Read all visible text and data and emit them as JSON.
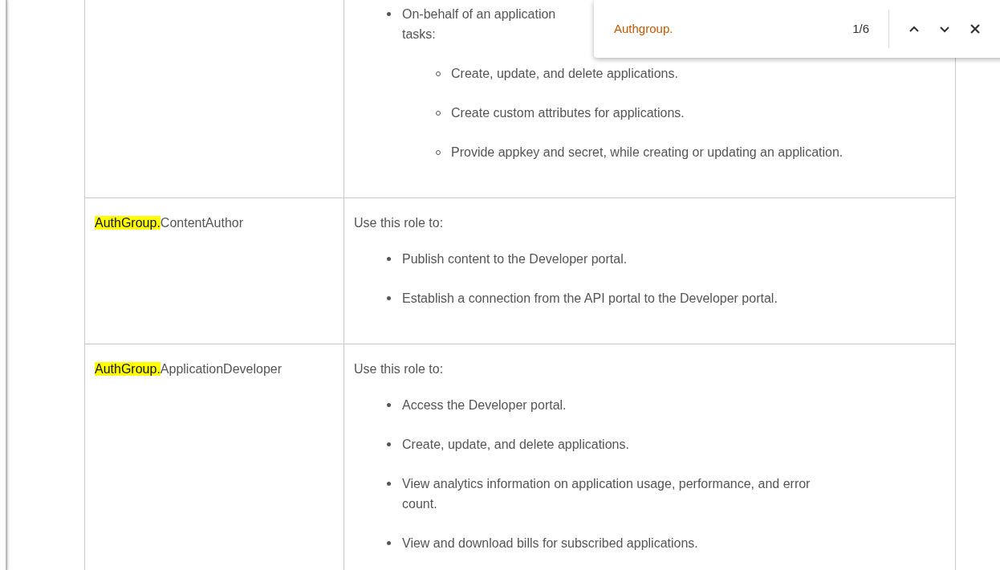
{
  "table": {
    "rows": [
      {
        "highlight": "",
        "role": "",
        "intro": "",
        "items": [
          {
            "lines": [
              "On-behalf of an application",
              "tasks:"
            ],
            "children": [
              {
                "lines": [
                  "Create, update, and delete applications."
                ]
              },
              {
                "lines": [
                  "Create custom attributes for applications."
                ]
              },
              {
                "lines": [
                  "Provide appkey and secret, while creating or updating an application."
                ]
              }
            ]
          }
        ]
      },
      {
        "highlight": "AuthGroup.",
        "role": "ContentAuthor",
        "intro": "Use this role to:",
        "items": [
          {
            "lines": [
              "Publish content to the Developer portal."
            ]
          },
          {
            "lines": [
              "Establish a connection from the API portal to the Developer portal."
            ]
          }
        ]
      },
      {
        "highlight": "AuthGroup.",
        "role": "ApplicationDeveloper",
        "intro": "Use this role to:",
        "items": [
          {
            "lines": [
              "Access the Developer portal."
            ]
          },
          {
            "lines": [
              "Create, update, and delete applications."
            ]
          },
          {
            "lines": [
              "View analytics information on application usage, performance, and error",
              "count."
            ]
          },
          {
            "lines": [
              "View and download bills for subscribed applications."
            ]
          }
        ]
      }
    ]
  },
  "find_bar": {
    "query": "Authgroup.",
    "count": "1/6"
  }
}
